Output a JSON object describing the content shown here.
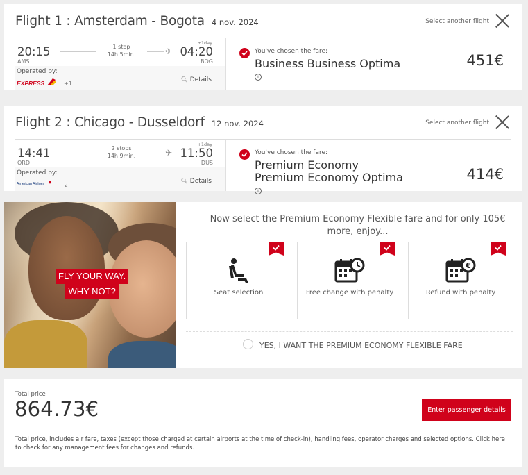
{
  "flights": [
    {
      "title": "Flight 1 : Amsterdam - Bogota",
      "date": "4 nov. 2024",
      "select_another": "Select another flight",
      "dep_time": "20:15",
      "dep_code": "AMS",
      "arr_time": "04:20",
      "arr_code": "BOG",
      "plus_day": "+1day",
      "stops": "1 stop",
      "duration": "14h 5min.",
      "operated_by": "Operated by:",
      "operator_logo": "IBERIA EXPRESS",
      "operator_more": "+1",
      "details": "Details",
      "chosen_label": "You've chosen the fare:",
      "fare_name": "Business Business Optima",
      "price": "451€"
    },
    {
      "title": "Flight 2 : Chicago - Dusseldorf",
      "date": "12 nov. 2024",
      "select_another": "Select another flight",
      "dep_time": "14:41",
      "dep_code": "ORD",
      "arr_time": "11:50",
      "arr_code": "DUS",
      "plus_day": "+1day",
      "stops": "2 stops",
      "duration": "14h 9min.",
      "operated_by": "Operated by:",
      "operator_logo": "American Airlines",
      "operator_more": "+2",
      "details": "Details",
      "chosen_label": "You've chosen the fare:",
      "fare_name": "Premium Economy Premium Economy Optima",
      "price": "414€"
    }
  ],
  "upsell": {
    "promo_line1": "FLY YOUR WAY.",
    "promo_line2": "WHY NOT?",
    "headline": "Now select the Premium Economy Flexible fare and for only 105€ more, enjoy...",
    "benefits": [
      {
        "label": "Seat selection",
        "icon": "seat-icon"
      },
      {
        "label": "Free change with penalty",
        "icon": "calendar-clock-icon"
      },
      {
        "label": "Refund with penalty",
        "icon": "calendar-euro-icon"
      }
    ],
    "option_label": "YES, I WANT THE PREMIUM ECONOMY FLEXIBLE FARE"
  },
  "total": {
    "label": "Total price",
    "price": "864.73€",
    "cta": "Enter passenger details",
    "note_1": "Total price, includes air fare, ",
    "note_taxes": "taxes",
    "note_2": " (except those charged at certain airports at the time of check-in), handling fees, operator charges and selected options. Click ",
    "note_here": "here",
    "note_3": " to check for any management fees for changes and refunds."
  },
  "colors": {
    "accent": "#d0021b",
    "background": "#eeeeee"
  }
}
